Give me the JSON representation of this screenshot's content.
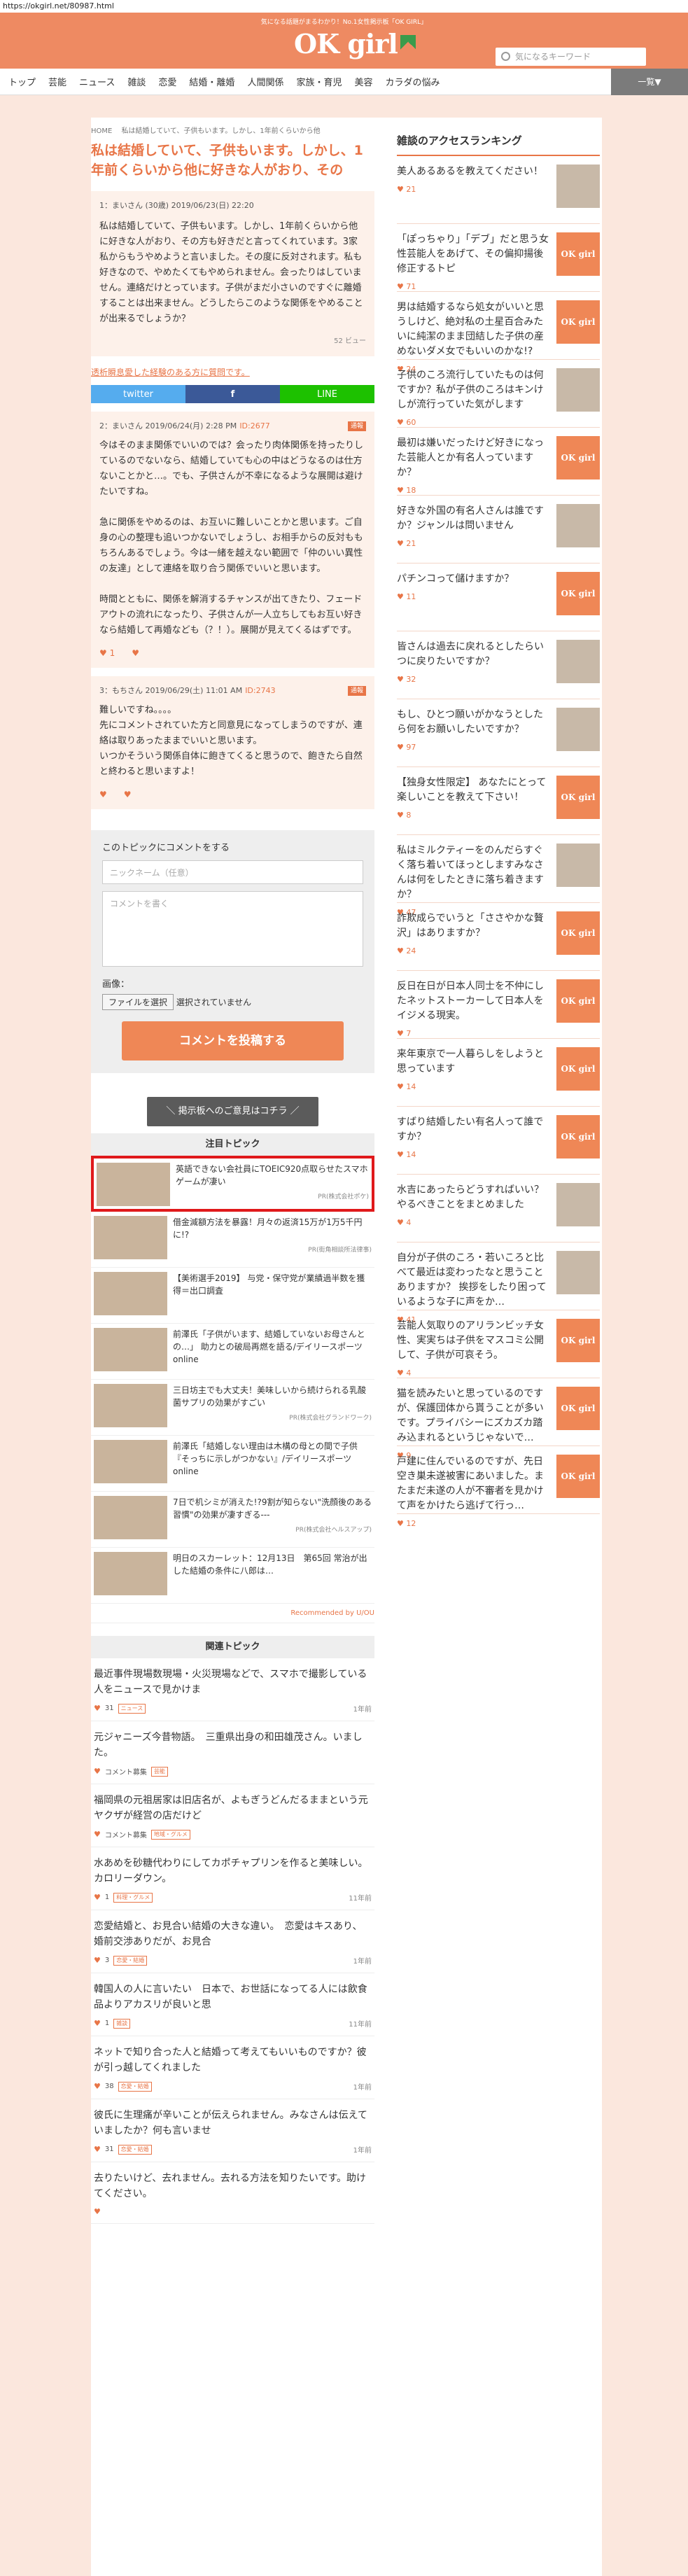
{
  "url": "https://okgirl.net/80987.html",
  "header": {
    "tagline": "気になる話題がまるわかり！No.1女性掲示板「OK GIRL」",
    "logo": "OK girl",
    "search_placeholder": "気になるキーワード"
  },
  "nav": {
    "items": [
      "トップ",
      "芸能",
      "ニュース",
      "雑談",
      "恋愛",
      "結婚・離婚",
      "人間関係",
      "家族・育児",
      "美容",
      "カラダの悩み"
    ],
    "more": "一覧▼"
  },
  "breadcrumb": "HOME　 私は結婚していて、子供もいます。しかし、1年前くらいから他",
  "title": "私は結婚していて、子供もいます。しかし、1年前くらいから他に好きな人がおり、その",
  "post": {
    "meta": "1：まいさん (30歳) 2019/06/23(日) 22:20",
    "body": "私は結婚していて、子供もいます。しかし、1年前くらいから他に好きな人がおり、その方も好きだと言ってくれています。3家私からもうやめようと言いました。その度に反対されます。私も好きなので、やめたくてもやめられません。会ったりはしていません。連絡だけとっています。子供がまだ小さいのですぐに離婚することは出来ません。どうしたらこのような関係をやめることが出来るでしょうか？",
    "views": "52 ビュー"
  },
  "related_link": "透析瞬息愛した経験のある方に質問です。",
  "share": {
    "twitter": "twitter",
    "facebook": "f",
    "line": "LINE"
  },
  "comments": [
    {
      "meta": "2：まいさん 2019/06/24(月) 2:28 PM",
      "id": "ID:2677",
      "report": "通報",
      "body": "今はそのまま関係でいいのでは？会ったり肉体関係を持ったりしているのでないなら、結婚していても心の中はどうなるのは仕方ないことかと…。でも、子供さんが不幸になるような展開は避けたいですね。\n\n急に関係をやめるのは、お互いに難しいことかと思います。ご自身の心の整理も追いつかないでしょうし、お相手からの反対ももちろんあるでしょう。今は一緒を越えない範囲で「仲のいい異性の友達」として連絡を取り合う関係でいいと思います。\n\n時間とともに、関係を解消するチャンスが出てきたり、フェードアウトの流れになったり、子供さんが一人立ちしてもお互い好きなら結婚して再婚なども（？！）。展開が見えてくるはずです。",
      "up": "1",
      "down": ""
    },
    {
      "meta": "3：もちさん 2019/06/29(土) 11:01 AM",
      "id": "ID:2743",
      "report": "通報",
      "body": "難しいですね。。。。\n先にコメントされていた方と同意見になってしまうのですが、連絡は取りあったままでいいと思います。\nいつかそういう関係自体に飽きてくると思うので、飽きたら自然と終わると思いますよ！",
      "up": "",
      "down": ""
    }
  ],
  "form": {
    "heading": "このトピックにコメントをする",
    "name_placeholder": "ニックネーム（任意）",
    "comment_placeholder": "コメントを書く",
    "image_label": "画像：",
    "file_button": "ファイルを選択",
    "file_status": "選択されていません",
    "submit": "コメントを投稿する"
  },
  "bbs_button": "＼ 掲示板へのご意見はコチラ ／",
  "featured": {
    "heading": "注目トピック",
    "items": [
      {
        "title": "英語できない会社員にTOEIC920点取らせたスマホゲームが凄い",
        "pr": "PR(株式会社ポケ)"
      },
      {
        "title": "借金減額方法を暴露！月々の返済15万が1万5千円に!?",
        "pr": "PR(街角相談所法律事)"
      },
      {
        "title": "【美術選手2019】 与党・保守党が業績過半数を獲得＝出口調査",
        "pr": ""
      },
      {
        "title": "前澤氏「子供がいます、結婚していないお母さんとの…」 助力との破局再燃を語る/デイリースポーツ online",
        "pr": ""
      },
      {
        "title": "三日坊主でも大丈夫！美味しいから続けられる乳酸菌サプリの効果がすごい",
        "pr": "PR(株式会社グランドワーク)"
      },
      {
        "title": "前澤氏「結婚しない理由は木構の母との間で子供『そっちに示しがつかない』/デイリースポーツ online",
        "pr": ""
      },
      {
        "title": "7日で机シミが消えた!?9割が知らない\"洗顔後のある習慣\"の効果が凄すぎる---",
        "pr": "PR(株式会社ヘルスアップ)"
      },
      {
        "title": "明日のスカーレット：12月13日　第65回 常治が出した結婚の条件に八郎は…",
        "pr": ""
      }
    ],
    "reco": "Recommended by U/OU"
  },
  "related": {
    "heading": "関連トピック",
    "items": [
      {
        "title": "最近事件現場数現場・火災現場などで、スマホで撮影している人をニュースで見かけま",
        "count": "31",
        "tag": "ニュース",
        "time": "1年前"
      },
      {
        "title": "元ジャニーズ今昔物語。　三重県出身の和田雄茂さん。いました。",
        "count": "コメント募集",
        "tag": "芸能",
        "time": ""
      },
      {
        "title": "福岡県の元祖居家は旧店名が、よもぎうどんだるままという元ヤクザが経営の店だけど",
        "count": "コメント募集",
        "tag": "地域・グルメ",
        "time": ""
      },
      {
        "title": "水あめを砂糖代わりにしてカポチャプリンを作ると美味しい。　カロリーダウン。",
        "count": "1",
        "tag": "料理・グルメ",
        "time": "11年前"
      },
      {
        "title": "恋愛結婚と、お見合い結婚の大きな違い。　恋愛はキスあり、婚前交渉ありだが、お見合",
        "count": "3",
        "tag": "恋愛・結婚",
        "time": "1年前"
      },
      {
        "title": "韓国人の人に言いたい　日本で、お世話になってる人には飲食品よりアカスリが良いと思",
        "count": "1",
        "tag": "雑談",
        "time": "11年前"
      },
      {
        "title": "ネットで知り合った人と結婚って考えてもいいものですか？彼が引っ越してくれました",
        "count": "38",
        "tag": "恋愛・結婚",
        "time": "1年前"
      },
      {
        "title": "彼氏に生理痛が辛いことが伝えられません。みなさんは伝えていましたか？何も言いませ",
        "count": "31",
        "tag": "恋愛・結婚",
        "time": "1年前"
      },
      {
        "title": "去りたいけど、去れません。去れる方法を知りたいです。助けてください。",
        "count": "",
        "tag": "",
        "time": ""
      }
    ]
  },
  "ranking": {
    "heading": "雑談のアクセスランキング",
    "items": [
      {
        "title": "美人あるあるを教えてください！",
        "count": "21",
        "thumb": "photo"
      },
      {
        "title": "「ぽっちゃり」「デブ」だと思う女性芸能人をあげて、その偏抑揚後修正するトピ",
        "count": "71",
        "thumb": "logo"
      },
      {
        "title": "男は結婚するなら処女がいいと思うしけど、絶対私の土星百合みたいに純潔のまま団結した子供の産めないダメ女でもいいのかな!?",
        "count": "24",
        "thumb": "logo"
      },
      {
        "title": "子供のころ流行していたものは何ですか？私が子供のころはキンけしが流行っていた気がします",
        "count": "60",
        "thumb": "photo"
      },
      {
        "title": "最初は嫌いだったけど好きになった芸能人とか有名人っていますか？",
        "count": "18",
        "thumb": "logo"
      },
      {
        "title": "好きな外国の有名人さんは誰ですか？ジャンルは問いません",
        "count": "21",
        "thumb": "photo"
      },
      {
        "title": "パチンコって儲けますか？",
        "count": "11",
        "thumb": "logo"
      },
      {
        "title": "皆さんは過去に戻れるとしたらいつに戻りたいですか？",
        "count": "32",
        "thumb": "photo"
      },
      {
        "title": "もし、ひとつ願いがかなうとしたら何をお願いしたいですか？",
        "count": "97",
        "thumb": "photo"
      },
      {
        "title": "【独身女性限定】 あなたにとって楽しいことを教えて下さい！",
        "count": "8",
        "thumb": "logo"
      },
      {
        "title": "私はミルクティーをのんだらすぐく落ち着いてほっとしますみなさんは何をしたときに落ち着きますか？",
        "count": "47",
        "thumb": "photo"
      },
      {
        "title": "詐欺成らでいうと「ささやかな贅沢」はありますか？",
        "count": "24",
        "thumb": "logo"
      },
      {
        "title": "反日在日が日本人同士を不仲にしたネットストーカーして日本人をイジメる現実。",
        "count": "7",
        "thumb": "logo"
      },
      {
        "title": "来年東京で一人暮らしをしようと思っています",
        "count": "14",
        "thumb": "logo"
      },
      {
        "title": "すばり結婚したい有名人って誰ですか？",
        "count": "14",
        "thumb": "logo"
      },
      {
        "title": "水吉にあったらどうすればいい？やるべきことをまとめました",
        "count": "4",
        "thumb": "photo"
      },
      {
        "title": "自分が子供のころ・若いころと比べて最近は変わったなと思うことありますか？ 挨拶をしたり困っているような子に声をか…",
        "count": "41",
        "thumb": "photo"
      },
      {
        "title": "芸能人気取りのアリランビッチ女性、実実ちは子供をマスコミ公開して、子供が可哀そう。",
        "count": "4",
        "thumb": "logo"
      },
      {
        "title": "猫を読みたいと思っているのですが、保護団体から貰うことが多いです。プライバシーにズカズカ踏み込まれるというじゃないで…",
        "count": "9",
        "thumb": "logo"
      },
      {
        "title": "戸建に住んでいるのですが、先日空き巣未遂被害にあいました。またまだ未遂の人が不審者を見かけて声をかけたら逃げて行っ…",
        "count": "12",
        "thumb": "logo"
      }
    ]
  }
}
